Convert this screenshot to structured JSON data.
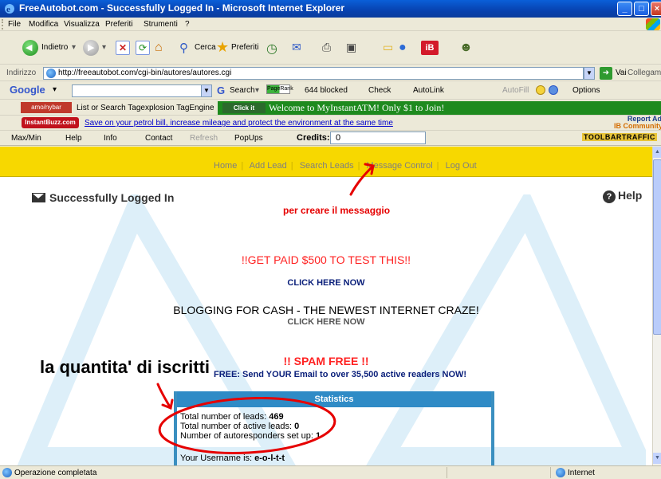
{
  "window": {
    "title": "FreeAutobot.com - Successfully Logged In - Microsoft Internet Explorer"
  },
  "menu": [
    "File",
    "Modifica",
    "Visualizza",
    "Preferiti",
    "Strumenti",
    "?"
  ],
  "toolbar": {
    "back_label": "Indietro",
    "search_label": "Cerca",
    "favorites_label": "Preferiti"
  },
  "address": {
    "label": "Indirizzo",
    "url": "http://freeautobot.com/cgi-bin/autores/autores.cgi",
    "go_label": "Vai",
    "links_label": "Collegamenti"
  },
  "google_bar": {
    "logo": "Google",
    "search_label": "Search",
    "pagerank": "PageRank",
    "blocked": "644 blocked",
    "check": "Check",
    "autolink": "AutoLink",
    "autofill": "AutoFill",
    "options": "Options"
  },
  "tag_bar": {
    "logo": "amo/nybar",
    "text": "List or Search Tagexplosion TagEngine",
    "banner_click": "Click it",
    "banner": "Welcome to MyInstantATM! Only $1 to Join!"
  },
  "buzz_bar": {
    "logo": "InstantBuzz.com",
    "link": "Save on your petrol bill, increase mileage and protect the environment at the same time",
    "report_ad": "Report Ad",
    "community": "IB Community"
  },
  "ar_bar": {
    "items": [
      "Max/Min",
      "Help",
      "Info",
      "Contact",
      "Refresh",
      "PopUps"
    ],
    "credits_label": "Credits:",
    "credits_value": "0",
    "brand": "TOOLBARTRAFFIC"
  },
  "site_nav": [
    "Home",
    "Add Lead",
    "Search Leads",
    "Message Control",
    "Log Out"
  ],
  "page": {
    "logged_in": "Successfully Logged In",
    "help": "Help",
    "annotation_message": "per creare il messaggio",
    "paid": "!!GET PAID $500 TO TEST THIS!!",
    "click_here_1": "CLICK HERE NOW",
    "blogging": "BLOGGING FOR CASH - THE NEWEST INTERNET CRAZE!",
    "click_here_2": "CLICK HERE NOW",
    "spam_free": "!! SPAM FREE !!",
    "free_send": "FREE: Send YOUR Email to over 35,500 active readers NOW!",
    "annotation_subscribers": "la quantita' di iscritti"
  },
  "stats": {
    "title": "Statistics",
    "total_leads_label": "Total number of leads:",
    "total_leads": "469",
    "active_leads_label": "Total number of active leads:",
    "active_leads": "0",
    "autoresponders_label": "Number of autoresponders set up:",
    "autoresponders": "1",
    "username_label": "Your Username is:",
    "username": "e-o-l-t-t"
  },
  "status": {
    "text": "Operazione completata",
    "zone": "Internet"
  }
}
